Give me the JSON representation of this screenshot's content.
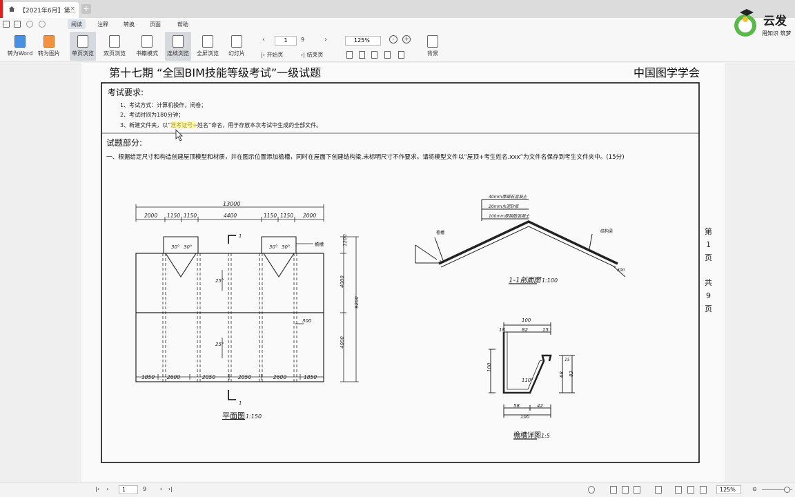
{
  "tab": {
    "title": "【2021年6月】第...",
    "close": "×",
    "add": "+"
  },
  "menu": [
    {
      "label": "阅读",
      "active": true
    },
    {
      "label": "注释"
    },
    {
      "label": "转换"
    },
    {
      "label": "页面"
    },
    {
      "label": "帮助"
    }
  ],
  "toolbar": {
    "to_word": "转为Word",
    "to_image": "转为图片",
    "single_page": "单页浏览",
    "double_page": "双页浏览",
    "book_mode": "书籍模式",
    "continuous": "连续浏览",
    "fullscreen": "全屏浏览",
    "slideshow": "幻灯片",
    "first_page": "开始页",
    "last_page": "结束页",
    "background": "背景",
    "current_page": "1",
    "total_pages": "9",
    "zoom": "125%"
  },
  "logo": {
    "text": "云发",
    "sub": "用知识 筑梦"
  },
  "doc": {
    "header_title": "第十七期 “全国BIM技能等级考试”一级试题",
    "header_org": "中国图学学会",
    "req_title": "考试要求:",
    "req_lines": [
      "1、考试方式：计算机操作，闭卷；",
      "2、考试时间为180分钟；",
      "3、新建文件夹，以“准考证号+姓名”命名，用于存放本次考试中生成的全部文件。"
    ],
    "q_title": "试题部分:",
    "q_text": "一、根据给定尺寸和构造创建屋顶模型和材质，并在图示位置添加檐槽，同时在屋面下创建结构梁,未标明尺寸不作要求。请将模型文件以“屋顶+考生姓名.xxx”为文件名保存到考生文件夹中。(15分)",
    "side_page": [
      "第",
      "1",
      "页",
      "共",
      "9",
      "页"
    ],
    "plan": {
      "total": "13000",
      "top_dims": [
        "2000",
        "1150",
        "1150",
        "4400",
        "1150",
        "1150",
        "2000"
      ],
      "bottom_dims": [
        "1850",
        "2600",
        "2050",
        "2050",
        "2600",
        "1850"
      ],
      "right_dims": [
        "1200",
        "4000",
        "4000"
      ],
      "right_total": "9200",
      "angles": [
        "30°",
        "30°",
        "30°",
        "30°"
      ],
      "slope_a": "25°",
      "slope_b": "25°",
      "gutter": "檐槽",
      "dim300": "300",
      "section_mark": "1",
      "title": "平面图",
      "scale": "1:150"
    },
    "section": {
      "layer1": "40mm厚细石混凝土",
      "layer2": "20mm水泥砂浆",
      "layer3": "100mm厚钢筋混凝土",
      "beam": "结构梁",
      "gutter": "檐槽",
      "dim": "300",
      "title": "1-1剖面图",
      "scale": "1:100"
    },
    "detail": {
      "top_total": "100",
      "top_parts": [
        "18",
        "82"
      ],
      "top_right": "15",
      "left": "100",
      "right_a": "68",
      "right_b": "83",
      "right_c": "15",
      "angle": "110°",
      "bottom_parts": [
        "58",
        "42"
      ],
      "bottom_total": "100",
      "title": "檐槽详图",
      "scale": "1:5"
    }
  },
  "status": {
    "page": "1",
    "total": "9",
    "zoom": "125%"
  }
}
